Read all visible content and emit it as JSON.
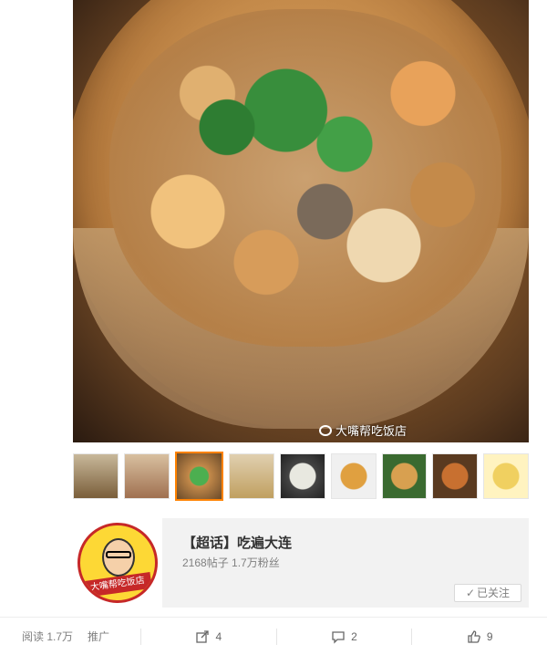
{
  "photo": {
    "watermark": "大嘴帮吃饭店"
  },
  "thumbnails": {
    "count": 9,
    "selected_index": 2
  },
  "topic": {
    "title": "【超话】吃遍大连",
    "stats": "2168帖子 1.7万粉丝",
    "follow_label": "已关注",
    "avatar_text": "大嘴帮吃饭店"
  },
  "actions": {
    "read": "阅读 1.7万",
    "promote": "推广",
    "share_count": "4",
    "comment_count": "2",
    "like_count": "9"
  },
  "colors": {
    "accent": "#ff8200",
    "muted_text": "#808080",
    "topic_bg": "#f2f2f2"
  }
}
